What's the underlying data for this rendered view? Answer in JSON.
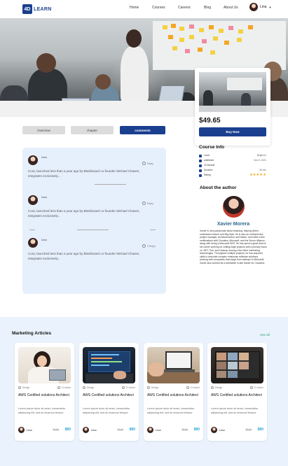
{
  "nav": {
    "logo_mark": "4D",
    "logo_text": "LEARN",
    "links": [
      "Home",
      "Courses",
      "Careers",
      "Blog",
      "About Us"
    ],
    "user_name": "Lina"
  },
  "course_card": {
    "price": "$49.65",
    "buy_label": "Buy Now"
  },
  "tabs": [
    "Overview",
    "chapter",
    "comments"
  ],
  "comments": [
    {
      "name": "Lina",
      "reply": "Reply",
      "text": "Cora, launched less than a year ago by Blackboard co-founder Michael Chasen, integrates exclusively..."
    },
    {
      "name": "Lina",
      "reply": "Reply",
      "text": "Cora, launched less than a year ago by Blackboard co-founder Michael Chasen, integrates exclusively..."
    },
    {
      "name": "Lina",
      "reply": "3 Reply",
      "text": "Cora, launched less than a year ago by Blackboard co-founder Michael Chasen, integrates exclusively..."
    }
  ],
  "course_info": {
    "title": "Course Info",
    "rows": [
      {
        "label": "Level",
        "value": "Beginner"
      },
      {
        "label": "published",
        "value": "Nov 8, 2021"
      },
      {
        "label": "20 Module",
        "value": ""
      },
      {
        "label": "Duration",
        "value": "26 min"
      },
      {
        "label": "Rating",
        "value": "★★★★★"
      }
    ],
    "rating": 5
  },
  "author": {
    "title": "About the author",
    "name": "Xavier Morera",
    "bio": "Xavier is very passionate about teaching, helping others understand search and Big Data. He is also an entrepreneur, project manager, technical author and trainer, and holds a few certifications with Cloudera, Microsoft, and the Scrum Alliance, along with being a Microsoft MVP. He has spent a great deal of his career working on cutting-edge projects with a primary focus on .NET, Solr, and Hadoop among a few other interesting technologies. Throughout multiple projects, he has acquired skills to deal with complex enterprise software solutions, working with companies that range from startups to Microsoft. Xavier also worked as a worldwide in-site trainer for Cloudera."
  },
  "articles": {
    "title": "Marketing Articles",
    "see_all": "See all",
    "items": [
      {
        "tag": "Design",
        "lessons": "3 Lesson",
        "name": "AWS Certified solutions Architect",
        "desc": "Lorem ipsum dolor sit amet, consectetur adipiscing elit, sed do eiusmod tempor",
        "author": "Lina",
        "old_price": "$100",
        "price": "$80"
      },
      {
        "tag": "Design",
        "lessons": "3 Lesson",
        "name": "AWS Certified solutions Architect",
        "desc": "Lorem ipsum dolor sit amet, consectetur adipiscing elit, sed do eiusmod tempor",
        "author": "Lina",
        "old_price": "$100",
        "price": "$80"
      },
      {
        "tag": "Design",
        "lessons": "3 Lesson",
        "name": "AWS Certified solutions Architect",
        "desc": "Lorem ipsum dolor sit amet, consectetur adipiscing elit, sed do eiusmod tempor",
        "author": "Lina",
        "old_price": "$100",
        "price": "$80"
      },
      {
        "tag": "Design",
        "lessons": "3 Lesson",
        "name": "AWS Certified solutions Architect",
        "desc": "Lorem ipsum dolor sit amet, consectetur adipiscing elit, sed do eiusmod tempor",
        "author": "Lina",
        "old_price": "$100",
        "price": "$80"
      }
    ]
  }
}
